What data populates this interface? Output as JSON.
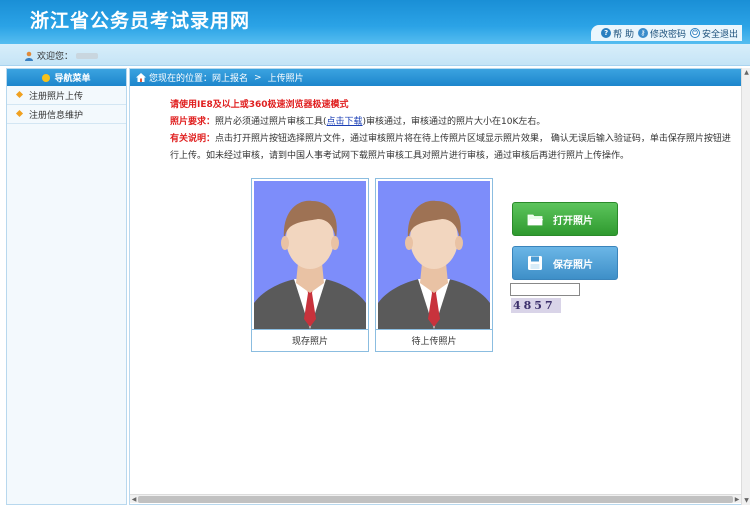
{
  "header": {
    "title": "浙江省公务员考试录用网",
    "links": [
      {
        "label": "帮 助",
        "icon": "help-icon"
      },
      {
        "label": "修改密码",
        "icon": "key-icon"
      },
      {
        "label": "安全退出",
        "icon": "power-icon"
      }
    ]
  },
  "user": {
    "welcome_label": "欢迎您："
  },
  "sidebar": {
    "title": "导航菜单",
    "items": [
      {
        "label": "注册照片上传"
      },
      {
        "label": "注册信息维护"
      }
    ]
  },
  "breadcrumb": {
    "prefix": "您现在的位置：网上报名",
    "separator": ">",
    "current": "上传照片"
  },
  "notes": {
    "browser_tip": "请使用IE8及以上或360极速浏览器极速模式",
    "photo_req_label": "照片要求：",
    "photo_req_text_1": "照片必须通过照片审核工具(",
    "download_link": "点击下载",
    "photo_req_text_2": ")审核通过，审核通过的照片大小在10K左右。",
    "related_label": "有关说明：",
    "related_text": "点击打开照片按钮选择照片文件，通过审核照片将在待上传照片区域显示照片效果， 确认无误后输入验证码，单击保存照片按钮进行上传。如未经过审核，请到中国人事考试网下载照片审核工具对照片进行审核，通过审核后再进行照片上传操作。"
  },
  "photos": {
    "current_caption": "现存照片",
    "pending_caption": "待上传照片"
  },
  "actions": {
    "open_label": "打开照片",
    "save_label": "保存照片"
  },
  "captcha": {
    "value": "",
    "code": "4857"
  },
  "colors": {
    "banner": "#1a8fd6",
    "accent_red": "#e02020",
    "open_button": "#3aa83a",
    "save_button": "#4a9ad2",
    "photo_bg": "#7d8dfa"
  }
}
